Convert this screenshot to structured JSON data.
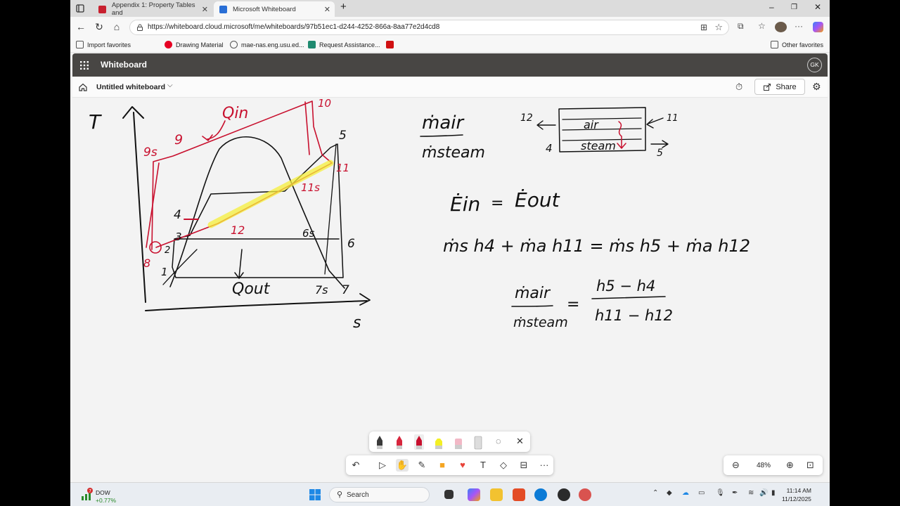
{
  "browser": {
    "tabs": [
      {
        "label": "Appendix 1: Property Tables and",
        "active": false
      },
      {
        "label": "Microsoft Whiteboard",
        "active": true
      }
    ],
    "url": "https://whiteboard.cloud.microsoft/me/whiteboards/97b51ec1-d244-4252-866a-8aa77e2d4cd8",
    "favorites": [
      {
        "label": "Import favorites"
      },
      {
        "label": "Drawing Material"
      },
      {
        "label": "mae-nas.eng.usu.ed..."
      },
      {
        "label": "Request Assistance..."
      }
    ],
    "other_favorites": "Other favorites"
  },
  "app": {
    "title": "Whiteboard",
    "user_initials": "GK",
    "doc_title": "Untitled whiteboard",
    "share_label": "Share"
  },
  "whiteboard": {
    "ts_labels": {
      "T": "T",
      "s": "s",
      "qin": "Qin",
      "p10": "10",
      "p5": "5",
      "p95": "9s",
      "p9": "9",
      "p11": "11",
      "p11s": "11s",
      "p4": "4",
      "p3": "3",
      "p12": "12",
      "p6s": "6s",
      "p6": "6",
      "p2": "2",
      "p8": "8",
      "p1": "1",
      "qout": "Qout",
      "p7s": "7s",
      "p7": "7"
    },
    "hx_labels": {
      "air": "air",
      "steam": "steam",
      "in_top": "11",
      "out_top": "12",
      "in_bot": "4",
      "out_bot": "5"
    },
    "equations": {
      "ratio_num": "ṁair",
      "ratio_den": "ṁsteam",
      "energy_left": "Ėin",
      "energy_eq": "=",
      "energy_right": "Ėout",
      "balance": "ṁs h4 + ṁa h11 = ṁs h5 + ṁa h12",
      "final_left_num": "ṁair",
      "final_left_den": "ṁsteam",
      "final_eq": "=",
      "final_right_num": "h5 − h4",
      "final_right_den": "h11 − h12"
    }
  },
  "zoom": {
    "value": "48%"
  },
  "taskbar": {
    "weather_badge": "7",
    "ticker": "DOW",
    "change": "+0.77%",
    "search_label": "Search",
    "time": "11:14 AM",
    "date": "11/12/2025"
  }
}
